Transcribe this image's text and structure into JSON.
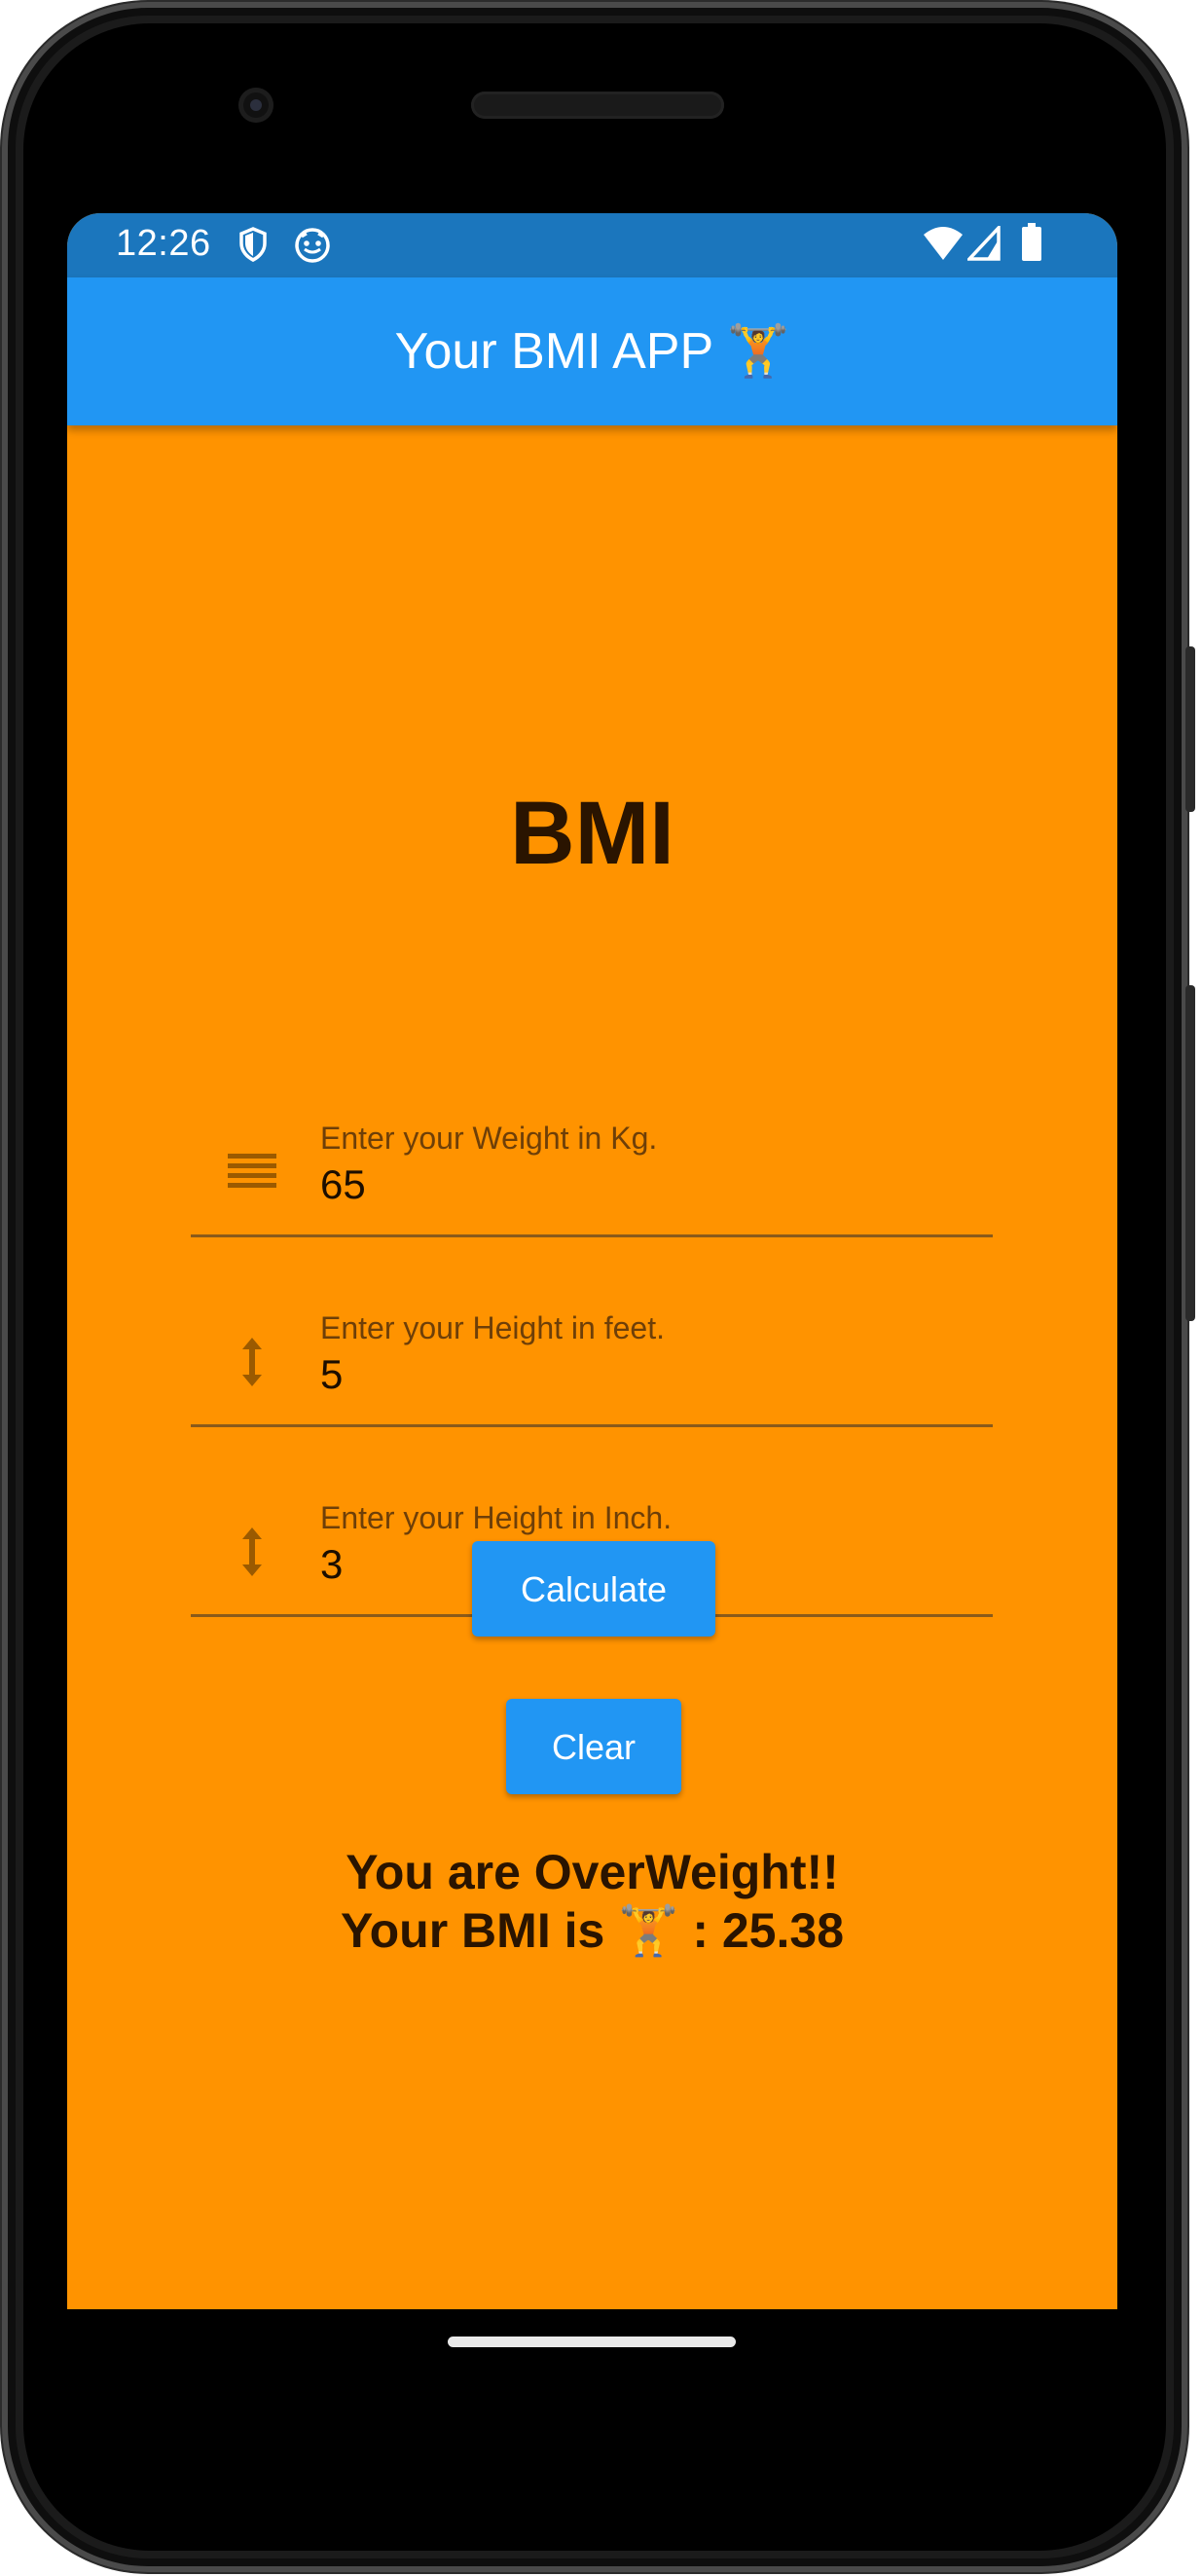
{
  "status_bar": {
    "time": "12:26",
    "icons": [
      "shield-icon",
      "app-notification-icon",
      "wifi-icon",
      "signal-icon",
      "battery-icon"
    ],
    "background": "#1b76bd"
  },
  "app_bar": {
    "title": "Your BMI APP 🏋️",
    "background": "#2196f3"
  },
  "main": {
    "heading": "BMI",
    "background": "#ff9300",
    "fields": [
      {
        "label": "Enter your Weight in Kg.",
        "value": "65",
        "icon": "weight-lines-icon"
      },
      {
        "label": "Enter your Height in feet.",
        "value": "5",
        "icon": "height-arrow-icon"
      },
      {
        "label": "Enter your Height in Inch.",
        "value": "3",
        "icon": "height-arrow-icon"
      }
    ],
    "buttons": {
      "calculate": "Calculate",
      "clear": "Clear"
    },
    "result": {
      "line1": "You are OverWeight!!",
      "line2": "Your BMI is 🏋️ : 25.38"
    }
  }
}
